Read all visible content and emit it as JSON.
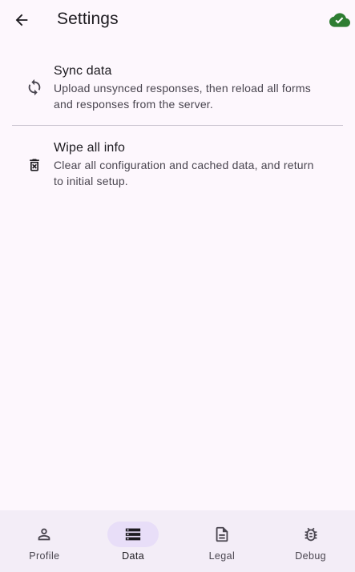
{
  "header": {
    "title": "Settings",
    "back_icon": "arrow-back-icon",
    "status_icon": "cloud-done-icon",
    "status_color": "#2e7d32"
  },
  "settings": {
    "items": [
      {
        "icon": "sync-icon",
        "title": "Sync data",
        "subtitle": "Upload unsynced responses, then reload all forms and responses from the server."
      },
      {
        "icon": "delete-forever-icon",
        "title": "Wipe all info",
        "subtitle": "Clear all configuration and cached data, and return to initial setup."
      }
    ]
  },
  "bottom_nav": {
    "selected": "Data",
    "items": [
      {
        "label": "Profile",
        "icon": "person-icon"
      },
      {
        "label": "Data",
        "icon": "storage-icon"
      },
      {
        "label": "Legal",
        "icon": "document-icon"
      },
      {
        "label": "Debug",
        "icon": "bug-icon"
      }
    ]
  },
  "colors": {
    "background": "#fdf7fd",
    "nav_background": "#f3edf7",
    "nav_indicator": "#e8def8",
    "divider": "#cac4d0",
    "text_primary": "#1d1b20",
    "text_secondary": "#49454f"
  }
}
